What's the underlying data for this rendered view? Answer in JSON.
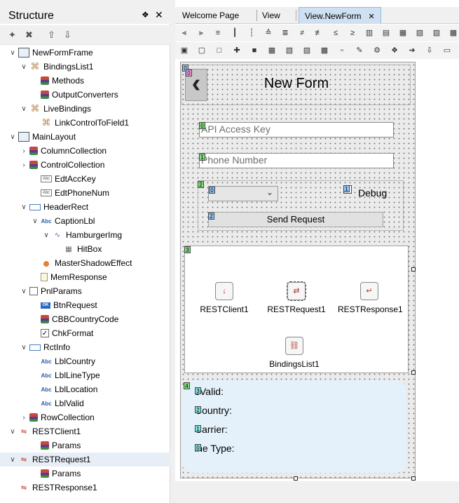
{
  "structure": {
    "title": "Structure",
    "pin_glyph": "❖",
    "close_glyph": "✕",
    "toolbar": [
      "✦",
      "✖",
      "⇧",
      "⇩"
    ],
    "items": [
      {
        "label": "NewFormFrame",
        "chev": "∨",
        "icon": "frame"
      },
      {
        "label": "BindingsList1",
        "chev": "∨",
        "icon": "bind"
      },
      {
        "label": "Methods",
        "chev": "",
        "icon": "comp"
      },
      {
        "label": "OutputConverters",
        "chev": "",
        "icon": "comp"
      },
      {
        "label": "LiveBindings",
        "chev": "∨",
        "icon": "bind"
      },
      {
        "label": "LinkControlToField1",
        "chev": "",
        "icon": "bind"
      },
      {
        "label": "MainLayout",
        "chev": "∨",
        "icon": "frame"
      },
      {
        "label": "ColumnCollection",
        "chev": "›",
        "icon": "comp"
      },
      {
        "label": "ControlCollection",
        "chev": "›",
        "icon": "comp"
      },
      {
        "label": "EdtAccKey",
        "chev": "",
        "icon": "edit"
      },
      {
        "label": "EdtPhoneNum",
        "chev": "",
        "icon": "edit"
      },
      {
        "label": "HeaderRect",
        "chev": "∨",
        "icon": "rect"
      },
      {
        "label": "CaptionLbl",
        "chev": "∨",
        "icon": "abc"
      },
      {
        "label": "HamburgerImg",
        "chev": "∨",
        "icon": "img"
      },
      {
        "label": "HitBox",
        "chev": "",
        "icon": "hit"
      },
      {
        "label": "MasterShadowEffect",
        "chev": "",
        "icon": "smile"
      },
      {
        "label": "MemResponse",
        "chev": "",
        "icon": "doc"
      },
      {
        "label": "PnlParams",
        "chev": "∨",
        "icon": "chk"
      },
      {
        "label": "BtnRequest",
        "chev": "",
        "icon": "ok"
      },
      {
        "label": "CBBCountryCode",
        "chev": "",
        "icon": "comp"
      },
      {
        "label": "ChkFormat",
        "chev": "",
        "icon": "chkon"
      },
      {
        "label": "RctInfo",
        "chev": "∨",
        "icon": "rect"
      },
      {
        "label": "LblCountry",
        "chev": "",
        "icon": "abc"
      },
      {
        "label": "LblLineType",
        "chev": "",
        "icon": "abc"
      },
      {
        "label": "LblLocation",
        "chev": "",
        "icon": "abc"
      },
      {
        "label": "LblValid",
        "chev": "",
        "icon": "abc"
      },
      {
        "label": "RowCollection",
        "chev": "›",
        "icon": "comp"
      },
      {
        "label": "RESTClient1",
        "chev": "∨",
        "icon": "rest"
      },
      {
        "label": "Params",
        "chev": "",
        "icon": "comp"
      },
      {
        "label": "RESTRequest1",
        "chev": "∨",
        "icon": "rest",
        "selected": true
      },
      {
        "label": "Params",
        "chev": "",
        "icon": "comp"
      },
      {
        "label": "RESTResponse1",
        "chev": "",
        "icon": "rest"
      }
    ]
  },
  "tabs": [
    {
      "label": "Welcome Page",
      "active": false
    },
    {
      "label": "View",
      "active": false
    },
    {
      "label": "View.NewForm",
      "active": true
    }
  ],
  "tab_close": "✕",
  "form": {
    "back_glyph": "‹",
    "caption": "New Form",
    "api_placeholder": "API Access Key",
    "phone_placeholder": "Phone Number",
    "combo_arrow": "⌄",
    "debug_label": "Debug",
    "send_label": "Send Request",
    "components": [
      {
        "label": "RESTClient1",
        "glyph": "↓"
      },
      {
        "label": "RESTRequest1",
        "glyph": "⇄"
      },
      {
        "label": "RESTResponse1",
        "glyph": "↵"
      },
      {
        "label": "BindingsList1",
        "glyph": "⛓"
      }
    ],
    "info_lines": [
      "sValid:",
      "Country:",
      "Carrier:",
      "ine Type:"
    ],
    "badges": {
      "header": "0",
      "back": "0",
      "api": "0",
      "phone": "1",
      "pnl": "2",
      "combo": "0",
      "chk": "1",
      "send": "2",
      "nv": "3",
      "rect": "4",
      "info": [
        "3",
        "2",
        "1",
        "0"
      ]
    }
  }
}
